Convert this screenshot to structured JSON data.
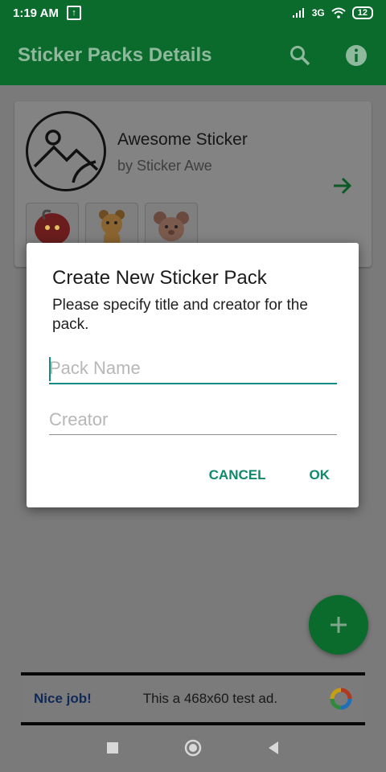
{
  "status_bar": {
    "time": "1:19 AM",
    "network": "3G",
    "battery": "12"
  },
  "app_bar": {
    "title": "Sticker Packs Details"
  },
  "pack": {
    "name": "Awesome Sticker",
    "author": "by Sticker Awe"
  },
  "dialog": {
    "title": "Create New Sticker Pack",
    "message": "Please specify title and creator for the pack.",
    "name_placeholder": "Pack Name",
    "creator_placeholder": "Creator",
    "cancel_label": "CANCEL",
    "ok_label": "OK"
  },
  "ad": {
    "nice": "Nice job!",
    "text": "This a 468x60 test ad."
  },
  "icons": {
    "upload": "upload-icon",
    "signal": "signal-icon",
    "wifi": "wifi-icon",
    "battery": "battery-icon",
    "search": "search-icon",
    "info": "info-icon",
    "tray": "tray-icon-image-placeholder",
    "arrow": "arrow-right-icon",
    "add": "plus-icon",
    "ad_logo": "ad-choices-logo",
    "nav_recents": "square-icon",
    "nav_home": "circle-icon",
    "nav_back": "back-triangle-icon"
  },
  "colors": {
    "primary": "#0a6b2c",
    "accent": "#128c7e",
    "dialog_button": "#0e8a6b",
    "scrim": "#7a7a7a"
  }
}
